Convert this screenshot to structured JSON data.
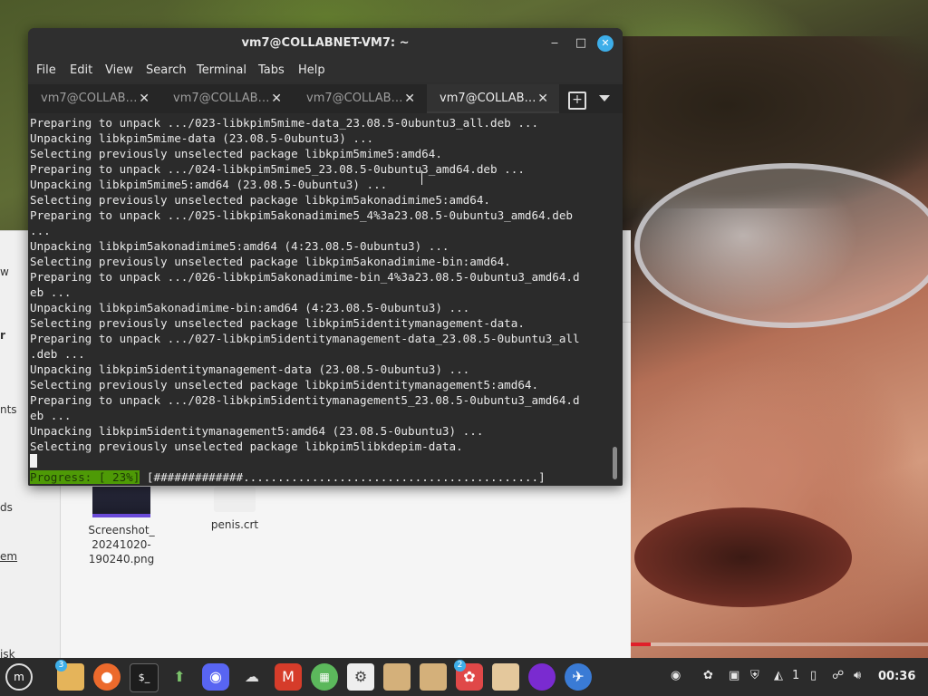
{
  "window": {
    "title": "vm7@COLLABNET-VM7: ~",
    "menu": [
      "File",
      "Edit",
      "View",
      "Search",
      "Terminal",
      "Tabs",
      "Help"
    ],
    "tabs": [
      "vm7@COLLAB…",
      "vm7@COLLAB…",
      "vm7@COLLAB…",
      "vm7@COLLAB…"
    ],
    "active_tab": 3
  },
  "terminal": {
    "lines": [
      "Preparing to unpack .../023-libkpim5mime-data_23.08.5-0ubuntu3_all.deb ...",
      "Unpacking libkpim5mime-data (23.08.5-0ubuntu3) ...",
      "Selecting previously unselected package libkpim5mime5:amd64.",
      "Preparing to unpack .../024-libkpim5mime5_23.08.5-0ubuntu3_amd64.deb ...",
      "Unpacking libkpim5mime5:amd64 (23.08.5-0ubuntu3) ...",
      "Selecting previously unselected package libkpim5akonadimime5:amd64.",
      "Preparing to unpack .../025-libkpim5akonadimime5_4%3a23.08.5-0ubuntu3_amd64.deb",
      "...",
      "Unpacking libkpim5akonadimime5:amd64 (4:23.08.5-0ubuntu3) ...",
      "Selecting previously unselected package libkpim5akonadimime-bin:amd64.",
      "Preparing to unpack .../026-libkpim5akonadimime-bin_4%3a23.08.5-0ubuntu3_amd64.d",
      "eb ...",
      "Unpacking libkpim5akonadimime-bin:amd64 (4:23.08.5-0ubuntu3) ...",
      "Selecting previously unselected package libkpim5identitymanagement-data.",
      "Preparing to unpack .../027-libkpim5identitymanagement-data_23.08.5-0ubuntu3_all",
      ".deb ...",
      "Unpacking libkpim5identitymanagement-data (23.08.5-0ubuntu3) ...",
      "Selecting previously unselected package libkpim5identitymanagement5:amd64.",
      "Preparing to unpack .../028-libkpim5identitymanagement5_23.08.5-0ubuntu3_amd64.d",
      "eb ...",
      "Unpacking libkpim5identitymanagement5:amd64 (23.08.5-0ubuntu3) ...",
      "Selecting previously unselected package libkpim5libkdepim-data."
    ],
    "progress_label": "Progress: [ 23%]",
    "progress_bar": "[#############...........................................]",
    "progress": 0.23
  },
  "file_manager": {
    "sidebar_fragments": [
      "w",
      "r",
      "nts",
      "ds",
      "em",
      "isk"
    ],
    "files": [
      {
        "name": "Screenshot_\n20241020-\n190240.png"
      },
      {
        "name": "penis.crt"
      }
    ]
  },
  "taskbar": {
    "apps": [
      {
        "icon": "mint-menu-icon"
      },
      {
        "icon": "folder-icon",
        "badge": "3"
      },
      {
        "icon": "firefox-icon"
      },
      {
        "icon": "terminal-icon"
      },
      {
        "icon": "update-manager-icon"
      },
      {
        "icon": "discord-icon"
      },
      {
        "icon": "cloud-icon"
      },
      {
        "icon": "mario-icon"
      },
      {
        "icon": "grid-app-icon"
      },
      {
        "icon": "settings-icon"
      },
      {
        "icon": "folder-icon-2"
      },
      {
        "icon": "folder-icon-3"
      },
      {
        "icon": "bee-app-icon",
        "badge": "2"
      },
      {
        "icon": "archive-icon"
      },
      {
        "icon": "purple-app-icon"
      },
      {
        "icon": "globe-app-icon"
      }
    ],
    "tray": {
      "notification_count": "1",
      "clock": "00:36"
    }
  },
  "colors": {
    "accent": "#3daee9",
    "terminal_bg": "#2b2b2b",
    "progress_green": "#4e9a06"
  }
}
